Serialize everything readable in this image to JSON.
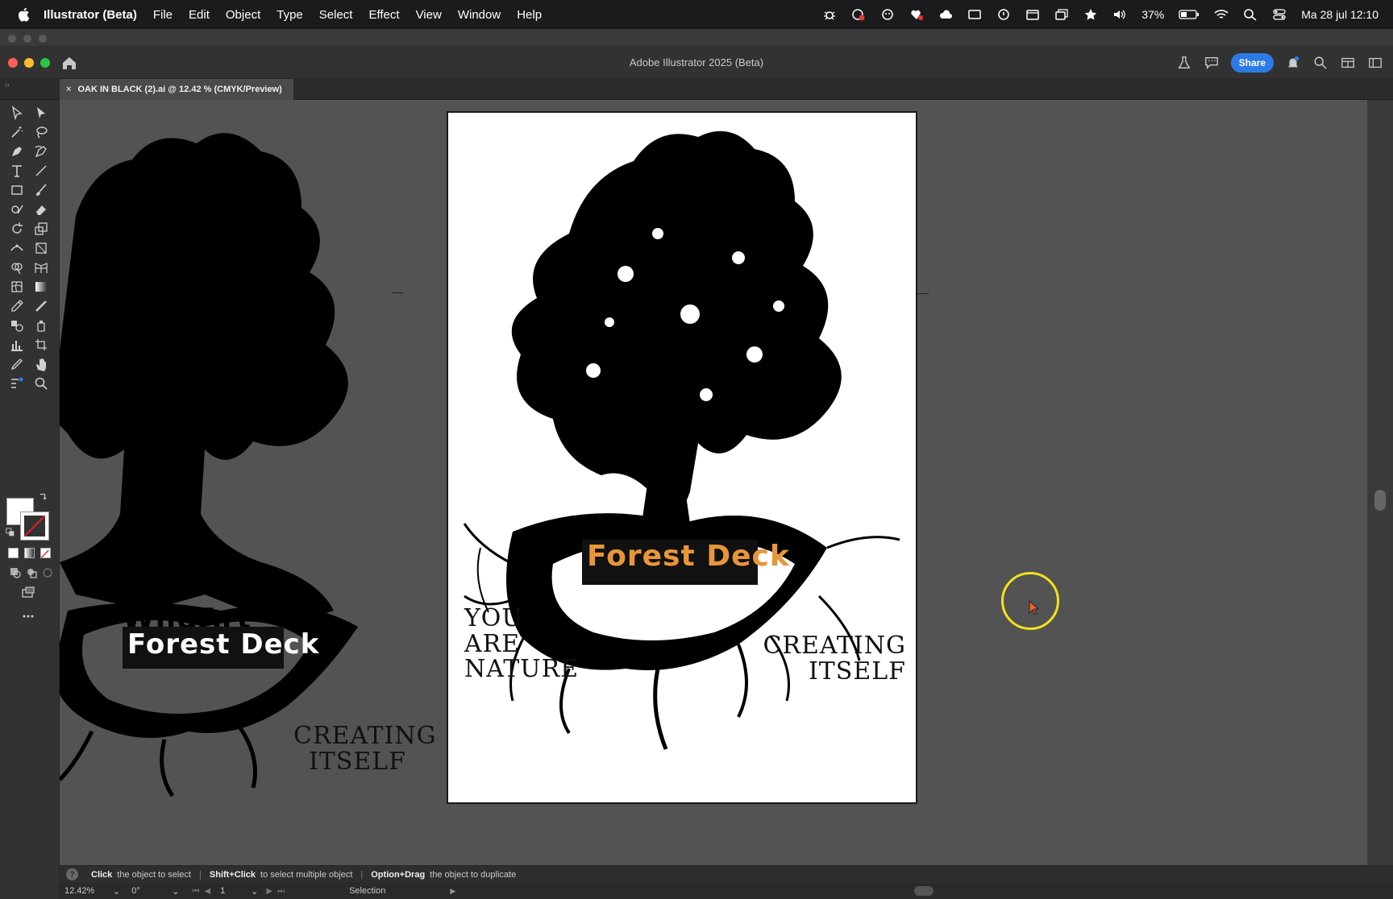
{
  "menubar": {
    "app_name": "Illustrator (Beta)",
    "items": [
      "File",
      "Edit",
      "Object",
      "Type",
      "Select",
      "Effect",
      "View",
      "Window",
      "Help"
    ],
    "battery": "37%",
    "datetime": "Ma 28 jul  12:10"
  },
  "window": {
    "title": "Adobe Illustrator 2025 (Beta)",
    "share_label": "Share"
  },
  "document_tab": {
    "label": "OAK IN BLACK (2).ai @ 12.42 % (CMYK/Preview)",
    "close_glyph": "×"
  },
  "artwork": {
    "brand_line1": "WildArt",
    "brand_line2": "Forest Deck",
    "left_text": [
      "YOU",
      "ARE",
      "NATURE"
    ],
    "right_text": [
      "CREATING",
      "ITSELF"
    ],
    "accent_color": "#e8963a"
  },
  "hint": {
    "part1_bold": "Click",
    "part1": "the object to select",
    "part2_bold": "Shift+Click",
    "part2": "to select multiple object",
    "part3_bold": "Option+Drag",
    "part3": "the object to duplicate",
    "separator": "|",
    "help_glyph": "?"
  },
  "statusbar": {
    "zoom": "12.42%",
    "rotation": "0°",
    "artboard": "1",
    "tool": "Selection"
  },
  "colors": {
    "traffic_red": "#ff5f57",
    "traffic_yellow": "#febc2e",
    "traffic_green": "#28c840",
    "cursor_ring": "#f4e21a"
  }
}
